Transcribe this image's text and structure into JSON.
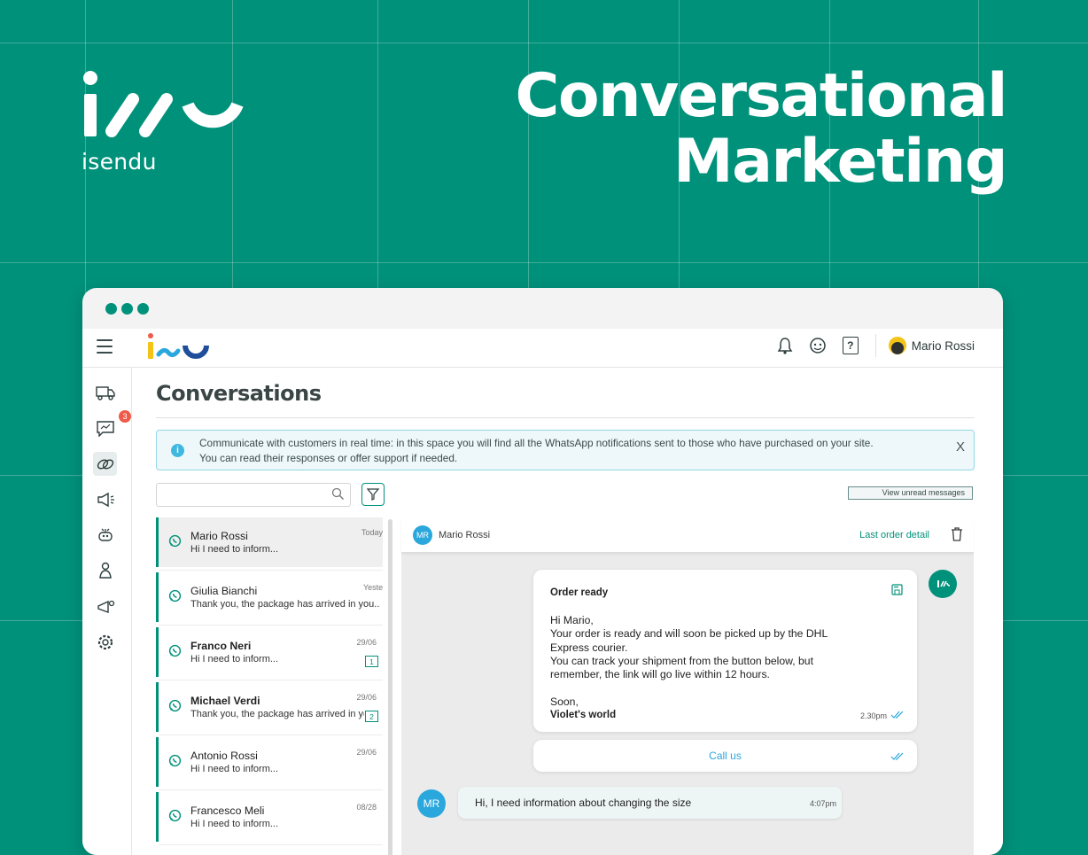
{
  "brand": {
    "name": "isendu"
  },
  "headline": {
    "line1": "Conversational",
    "line2": "Marketing"
  },
  "colors": {
    "brand_green": "#00917a",
    "accent_blue": "#2aa7dc",
    "badge_red": "#ee5b4a"
  },
  "topbar": {
    "icons": [
      "menu-icon",
      "bell-icon",
      "chat-support-icon",
      "help-icon"
    ],
    "help_label": "?",
    "user_name": "Mario Rossi"
  },
  "sidebar": {
    "icons": [
      "shipping-icon",
      "messages-icon",
      "integrations-icon",
      "campaign-icon",
      "robot-icon",
      "pet-icon",
      "marketing-icon",
      "settings-icon"
    ],
    "messages_badge": "3"
  },
  "page": {
    "title": "Conversations",
    "info_line1": "Communicate with customers in real time: in this space you will find all the WhatsApp notifications sent to those who have purchased on your site.",
    "info_line2": "You can read their responses or offer support if needed.",
    "info_close": "X",
    "search_placeholder": "",
    "unread_button": "View unread messages"
  },
  "conversations": [
    {
      "name": "Mario Rossi",
      "snippet": "Hi I need to inform...",
      "date": "Today",
      "count": "",
      "bold": false,
      "selected": true
    },
    {
      "name": "Giulia Bianchi",
      "snippet": "Thank you, the package has arrived in you...",
      "date": "Yesterday",
      "count": "",
      "bold": false,
      "selected": false
    },
    {
      "name": "Franco Neri",
      "snippet": "Hi I need to inform...",
      "date": "29/06",
      "count": "1",
      "bold": true,
      "selected": false
    },
    {
      "name": "Michael Verdi",
      "snippet": "Thank you, the package has arrived in your...",
      "date": "29/06",
      "count": "2",
      "bold": true,
      "selected": false
    },
    {
      "name": "Antonio Rossi",
      "snippet": "Hi I need to inform...",
      "date": "29/06",
      "count": "",
      "bold": false,
      "selected": false
    },
    {
      "name": "Francesco Meli",
      "snippet": "Hi I need to inform...",
      "date": "08/28",
      "count": "",
      "bold": false,
      "selected": false
    }
  ],
  "chat": {
    "contact_initials": "MR",
    "contact_name": "Mario Rossi",
    "last_order_link": "Last order detail",
    "template": {
      "title": "Order ready",
      "body": "Hi Mario,\nYour order is ready and will soon be picked up by the DHL\nExpress courier.\nYou can track your shipment from the button below, but\nremember, the link will go live within 12 hours.\n\nSoon,",
      "signature": "Violet's world",
      "time": "2.30pm",
      "button": "Call us"
    },
    "incoming": {
      "initials": "MR",
      "text": "Hi, I need information about changing the size",
      "time": "4:07pm"
    }
  }
}
